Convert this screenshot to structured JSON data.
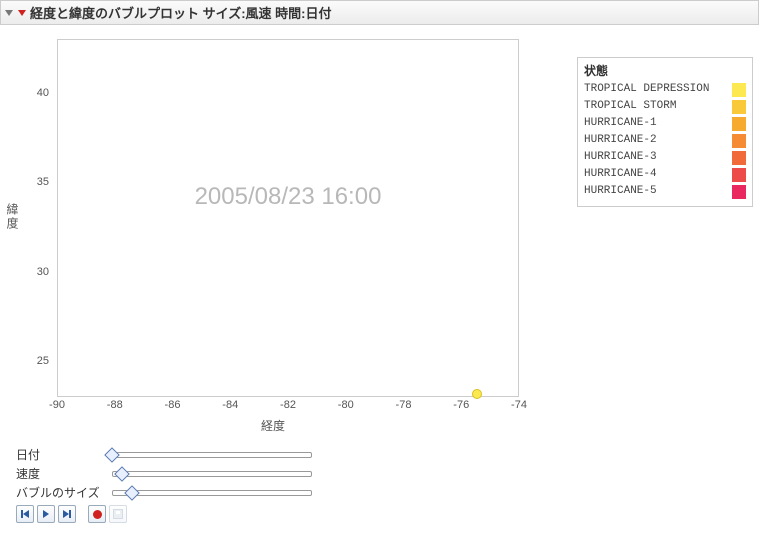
{
  "header": {
    "title": "経度と緯度のバブルプロット サイズ:風速 時間:日付"
  },
  "legend": {
    "title": "状態",
    "items": [
      {
        "label": "TROPICAL DEPRESSION",
        "color": "#fce850"
      },
      {
        "label": "TROPICAL STORM",
        "color": "#f9c93a"
      },
      {
        "label": "HURRICANE-1",
        "color": "#f7aa30"
      },
      {
        "label": "HURRICANE-2",
        "color": "#f58b33"
      },
      {
        "label": "HURRICANE-3",
        "color": "#f16a3a"
      },
      {
        "label": "HURRICANE-4",
        "color": "#ed4a4a"
      },
      {
        "label": "HURRICANE-5",
        "color": "#e8285e"
      }
    ]
  },
  "axes": {
    "xlabel": "経度",
    "ylabel": "緯度",
    "yticks": [
      "40",
      "35",
      "30",
      "25"
    ],
    "xticks": [
      "-90",
      "-88",
      "-86",
      "-84",
      "-82",
      "-80",
      "-78",
      "-76",
      "-74"
    ]
  },
  "timestamp": "2005/08/23 16:00",
  "controls": {
    "sliders": [
      {
        "label": "日付",
        "pos": 0.0
      },
      {
        "label": "速度",
        "pos": 0.05
      },
      {
        "label": "バブルのサイズ",
        "pos": 0.1
      }
    ]
  },
  "chart_data": {
    "type": "scatter",
    "title": "経度と緯度のバブルプロット サイズ:風速 時間:日付",
    "xlabel": "経度",
    "ylabel": "緯度",
    "xlim": [
      -90,
      -74
    ],
    "ylim": [
      23,
      43
    ],
    "timestamp": "2005/08/23 16:00",
    "size_encoding": "風速",
    "color_encoding": "状態",
    "color_scale": [
      {
        "category": "TROPICAL DEPRESSION",
        "color": "#fce850"
      },
      {
        "category": "TROPICAL STORM",
        "color": "#f9c93a"
      },
      {
        "category": "HURRICANE-1",
        "color": "#f7aa30"
      },
      {
        "category": "HURRICANE-2",
        "color": "#f58b33"
      },
      {
        "category": "HURRICANE-3",
        "color": "#f16a3a"
      },
      {
        "category": "HURRICANE-4",
        "color": "#ed4a4a"
      },
      {
        "category": "HURRICANE-5",
        "color": "#e8285e"
      }
    ],
    "points": [
      {
        "x": -75.5,
        "y": 23.2,
        "category": "TROPICAL DEPRESSION",
        "size_rel": 0.25
      }
    ]
  }
}
